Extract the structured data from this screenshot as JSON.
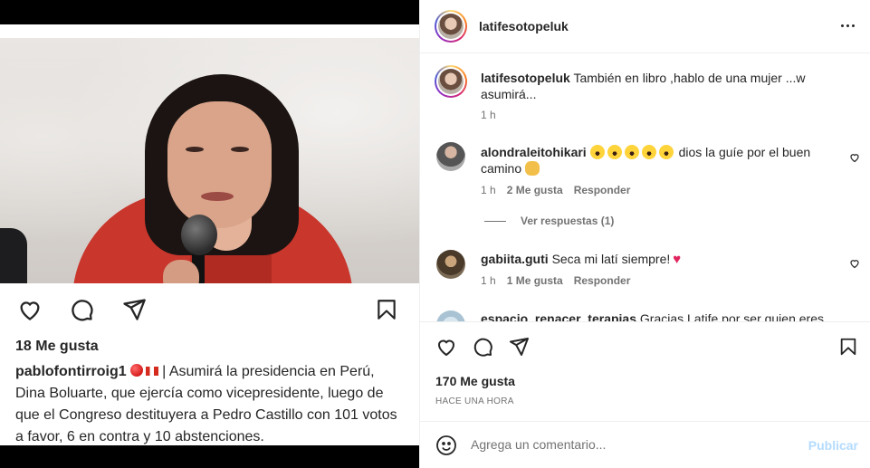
{
  "left_post": {
    "likes": "18 Me gusta",
    "caption_user": "pablofontirroig1",
    "caption_text": "| Asumirá la presidencia en Perú, Dina Boluarte, que ejercía como vicepresidente, luego de que el Congreso destituyera a Pedro Castillo con 101 votos a favor,  6 en contra y 10 abstenciones.",
    "icons": [
      "heart-icon",
      "comment-icon",
      "share-icon",
      "bookmark-icon"
    ]
  },
  "header": {
    "username": "latifesotopeluk",
    "more_icon": "more-options-icon"
  },
  "comments": [
    {
      "user": "latifesotopeluk",
      "text_line1": "También en libro ,hablo de una mujer ...w",
      "text_line2": "asumirá...",
      "time": "1 h"
    },
    {
      "user": "alondraleitohikari",
      "text_after_emoji": "dios la guíe por el buen",
      "text_line2": "camino",
      "time": "1 h",
      "likes": "2 Me gusta",
      "reply": "Responder",
      "view_replies": "Ver respuestas (1)"
    },
    {
      "user": "gabiita.guti",
      "text": "Seca mi latí siempre!",
      "time": "1 h",
      "likes": "1 Me gusta",
      "reply": "Responder"
    },
    {
      "user": "espacio_renacer_terapias",
      "text": "Gracias Latife por ser quien eres. Por"
    }
  ],
  "actions": {
    "likes": "170 Me gusta",
    "time": "Hace una hora",
    "icons": [
      "heart-icon",
      "comment-icon",
      "share-icon",
      "bookmark-icon"
    ]
  },
  "add_comment": {
    "placeholder": "Agrega un comentario...",
    "publish": "Publicar"
  },
  "colors": {
    "text": "#262626",
    "secondary": "#737373",
    "publish_disabled": "#b3dbff",
    "heart_red": "#e0245e"
  }
}
